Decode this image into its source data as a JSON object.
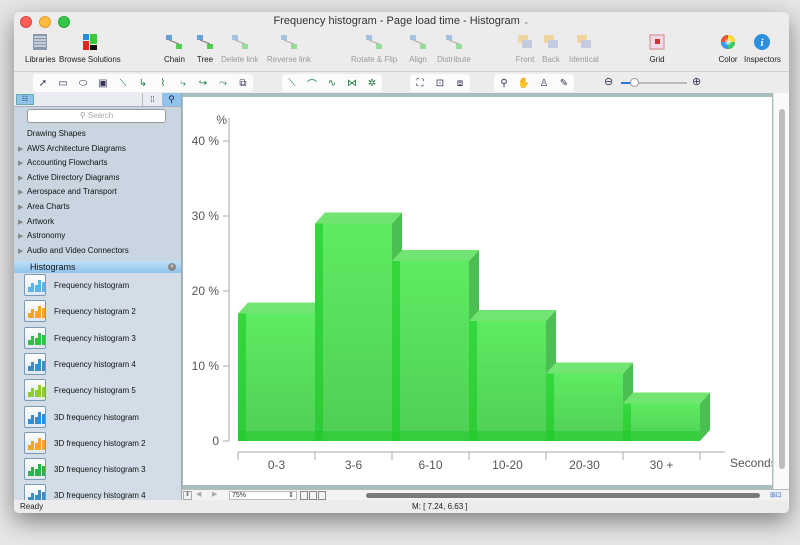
{
  "window": {
    "title": "Frequency histogram - Page load time - Histogram",
    "title_chevron": "⌄"
  },
  "toolbar": {
    "items": [
      {
        "label": "Libraries",
        "icon": "libraries-icon",
        "enabled": true
      },
      {
        "label": "Browse Solutions",
        "icon": "browse-solutions-icon",
        "enabled": true
      },
      {
        "label": "Chain",
        "icon": "chain-icon",
        "enabled": true
      },
      {
        "label": "Tree",
        "icon": "tree-icon",
        "enabled": true
      },
      {
        "label": "Delete link",
        "icon": "delete-link-icon",
        "enabled": false
      },
      {
        "label": "Reverse link",
        "icon": "reverse-link-icon",
        "enabled": false
      },
      {
        "label": "Rotate & Flip",
        "icon": "rotate-flip-icon",
        "enabled": false
      },
      {
        "label": "Align",
        "icon": "align-icon",
        "enabled": false
      },
      {
        "label": "Distribute",
        "icon": "distribute-icon",
        "enabled": false
      },
      {
        "label": "Front",
        "icon": "front-icon",
        "enabled": false
      },
      {
        "label": "Back",
        "icon": "back-icon",
        "enabled": false
      },
      {
        "label": "Identical",
        "icon": "identical-icon",
        "enabled": false
      },
      {
        "label": "Grid",
        "icon": "grid-icon",
        "enabled": true
      },
      {
        "label": "Color",
        "icon": "color-wheel-icon",
        "enabled": true
      },
      {
        "label": "Inspectors",
        "icon": "info-icon",
        "enabled": true
      }
    ]
  },
  "drawing_tools": {
    "groups": [
      [
        "pointer-icon",
        "rectangle-icon",
        "ellipse-icon",
        "text-box-icon",
        "direct-connector-icon",
        "arc-connector-icon",
        "bezier-connector-icon",
        "smart-connector-icon",
        "round-connector-icon",
        "curved-connector-icon",
        "insert-shape-icon"
      ],
      [
        "line-icon",
        "arc-icon",
        "bezier-icon",
        "poly-line-icon",
        "spline-icon"
      ],
      [
        "edit-points-icon",
        "container-icon",
        "group-icon"
      ],
      [
        "zoom-icon",
        "pan-hand-icon",
        "stamp-icon",
        "eyedropper-icon"
      ]
    ],
    "zoom_slider": {
      "value_fraction": 0.2
    }
  },
  "library_panel": {
    "search_placeholder": "Search",
    "libraries": [
      {
        "label": "Drawing Shapes",
        "expandable": false
      },
      {
        "label": "AWS Architecture Diagrams",
        "expandable": true
      },
      {
        "label": "Accounting Flowcharts",
        "expandable": true
      },
      {
        "label": "Active Directory Diagrams",
        "expandable": true
      },
      {
        "label": "Aerospace and Transport",
        "expandable": true
      },
      {
        "label": "Area Charts",
        "expandable": true
      },
      {
        "label": "Artwork",
        "expandable": true
      },
      {
        "label": "Astronomy",
        "expandable": true
      },
      {
        "label": "Audio and Video Connectors",
        "expandable": true
      }
    ],
    "open_library": {
      "title": "Histograms",
      "items": [
        {
          "label": "Frequency histogram",
          "color": "#5ab4ea"
        },
        {
          "label": "Frequency histogram 2",
          "color": "#f5a623"
        },
        {
          "label": "Frequency histogram 3",
          "color": "#2fc24a"
        },
        {
          "label": "Frequency histogram 4",
          "color": "#3a8fc8"
        },
        {
          "label": "Frequency histogram 5",
          "color": "#8ccf2a"
        },
        {
          "label": "3D frequency histogram",
          "color": "#2f8fd8"
        },
        {
          "label": "3D frequency histogram 2",
          "color": "#f5a623"
        },
        {
          "label": "3D frequency histogram 3",
          "color": "#2fb24a"
        },
        {
          "label": "3D frequency histogram 4",
          "color": "#3a8fc8"
        }
      ]
    }
  },
  "bottom_bar": {
    "zoom_value": "75%"
  },
  "status": {
    "ready": "Ready",
    "mouse_coords": "M: [ 7.24, 6.63 ]"
  },
  "chart_data": {
    "type": "bar",
    "title": "",
    "xlabel": "Seconds",
    "ylabel": "%",
    "categories": [
      "0-3",
      "3-6",
      "6-10",
      "10-20",
      "20-30",
      "30 +"
    ],
    "values": [
      17,
      29,
      24,
      16,
      9,
      5
    ],
    "ylim": [
      0,
      40
    ],
    "yticks": [
      "0",
      "10 %",
      "20 %",
      "30 %",
      "40 %"
    ],
    "bar_color": "#2fd63c",
    "style": "3d",
    "grid": false,
    "legend": "none"
  }
}
